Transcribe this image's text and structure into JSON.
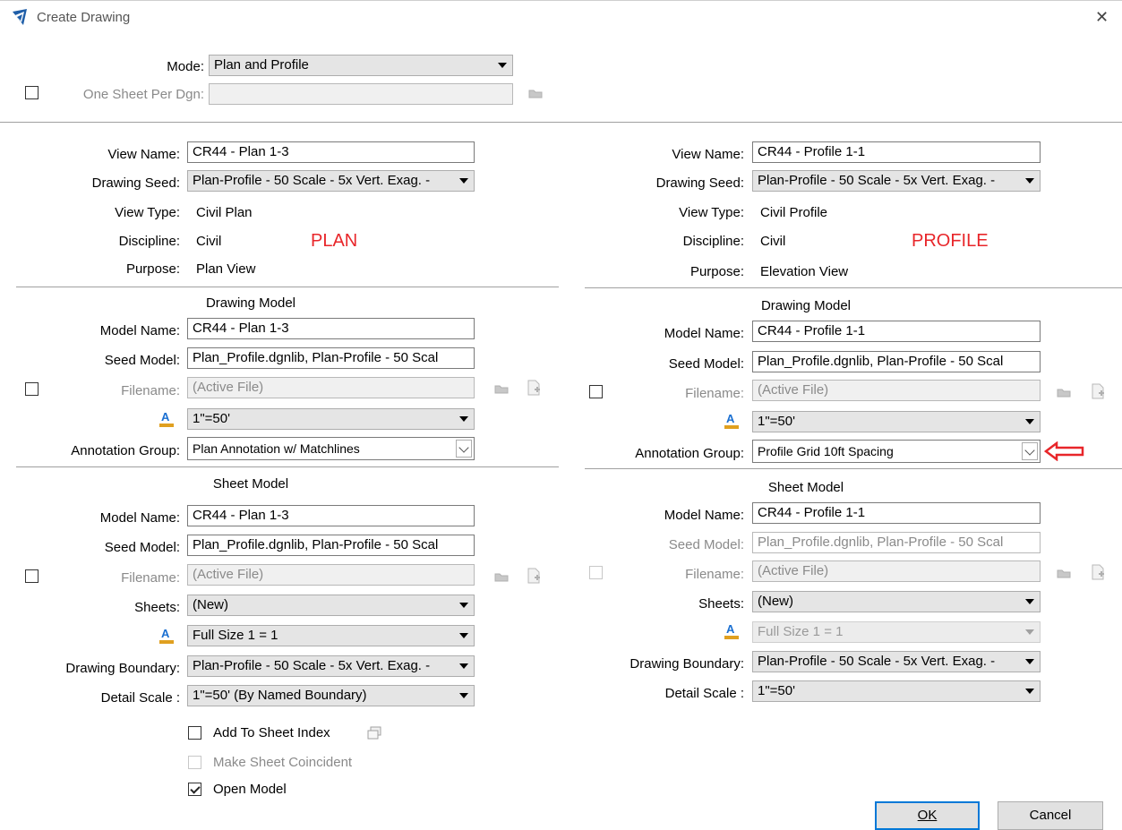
{
  "window": {
    "title": "Create Drawing",
    "close_glyph": "✕"
  },
  "top": {
    "mode_label": "Mode:",
    "mode_value": "Plan and Profile",
    "one_sheet_label": "One Sheet Per Dgn:",
    "one_sheet_value": ""
  },
  "plan": {
    "marker": "PLAN",
    "view_name_label": "View Name:",
    "view_name": "CR44 - Plan 1-3",
    "drawing_seed_label": "Drawing Seed:",
    "drawing_seed": "Plan-Profile - 50 Scale - 5x Vert. Exag. -",
    "view_type_label": "View Type:",
    "view_type": "Civil Plan",
    "discipline_label": "Discipline:",
    "discipline": "Civil",
    "purpose_label": "Purpose:",
    "purpose": "Plan View",
    "drawing_model": {
      "title": "Drawing Model",
      "model_name_label": "Model Name:",
      "model_name": "CR44 - Plan 1-3",
      "seed_model_label": "Seed Model:",
      "seed_model": "Plan_Profile.dgnlib, Plan-Profile - 50 Scal",
      "filename_label": "Filename:",
      "filename": "(Active File)",
      "annotation_scale": "1\"=50'",
      "annotation_group_label": "Annotation Group:",
      "annotation_group": "Plan Annotation w/ Matchlines"
    },
    "sheet_model": {
      "title": "Sheet Model",
      "model_name_label": "Model Name:",
      "model_name": "CR44 - Plan 1-3",
      "seed_model_label": "Seed Model:",
      "seed_model": "Plan_Profile.dgnlib, Plan-Profile - 50 Scal",
      "filename_label": "Filename:",
      "filename": "(Active File)",
      "sheets_label": "Sheets:",
      "sheets": "(New)",
      "annotation_scale": "Full Size 1 = 1",
      "drawing_boundary_label": "Drawing Boundary:",
      "drawing_boundary": "Plan-Profile - 50 Scale - 5x Vert. Exag. -",
      "detail_scale_label": "Detail Scale :",
      "detail_scale": "1\"=50' (By Named Boundary)"
    }
  },
  "profile": {
    "marker": "PROFILE",
    "view_name_label": "View Name:",
    "view_name": "CR44 - Profile 1-1",
    "drawing_seed_label": "Drawing Seed:",
    "drawing_seed": "Plan-Profile - 50 Scale - 5x Vert. Exag. -",
    "view_type_label": "View Type:",
    "view_type": "Civil Profile",
    "discipline_label": "Discipline:",
    "discipline": "Civil",
    "purpose_label": "Purpose:",
    "purpose": "Elevation View",
    "drawing_model": {
      "title": "Drawing Model",
      "model_name_label": "Model Name:",
      "model_name": "CR44 - Profile 1-1",
      "seed_model_label": "Seed Model:",
      "seed_model": "Plan_Profile.dgnlib, Plan-Profile - 50 Scal",
      "filename_label": "Filename:",
      "filename": "(Active File)",
      "annotation_scale": "1\"=50'",
      "annotation_group_label": "Annotation Group:",
      "annotation_group": "Profile Grid 10ft Spacing"
    },
    "sheet_model": {
      "title": "Sheet Model",
      "model_name_label": "Model Name:",
      "model_name": "CR44 - Profile 1-1",
      "seed_model_label": "Seed Model:",
      "seed_model": "Plan_Profile.dgnlib, Plan-Profile - 50 Scal",
      "filename_label": "Filename:",
      "filename": "(Active File)",
      "sheets_label": "Sheets:",
      "sheets": "(New)",
      "annotation_scale": "Full Size 1 = 1",
      "drawing_boundary_label": "Drawing Boundary:",
      "drawing_boundary": "Plan-Profile - 50 Scale - 5x Vert. Exag. -",
      "detail_scale_label": "Detail Scale :",
      "detail_scale": "1\"=50'"
    }
  },
  "options": {
    "add_to_sheet_index": "Add To Sheet Index",
    "make_sheet_coincident": "Make Sheet Coincident",
    "open_model": "Open Model"
  },
  "buttons": {
    "ok": "OK",
    "cancel": "Cancel"
  },
  "colors": {
    "marker_red": "#e8262a",
    "arrow_red": "#e8262a",
    "default_button_border": "#0078d7",
    "annotation_icon_blue": "#1a6fd1"
  },
  "icons": [
    "app-logo-icon",
    "close-icon",
    "folder-icon",
    "new-file-icon",
    "annotation-scale-icon",
    "sheet-index-icon",
    "red-arrow-icon"
  ]
}
